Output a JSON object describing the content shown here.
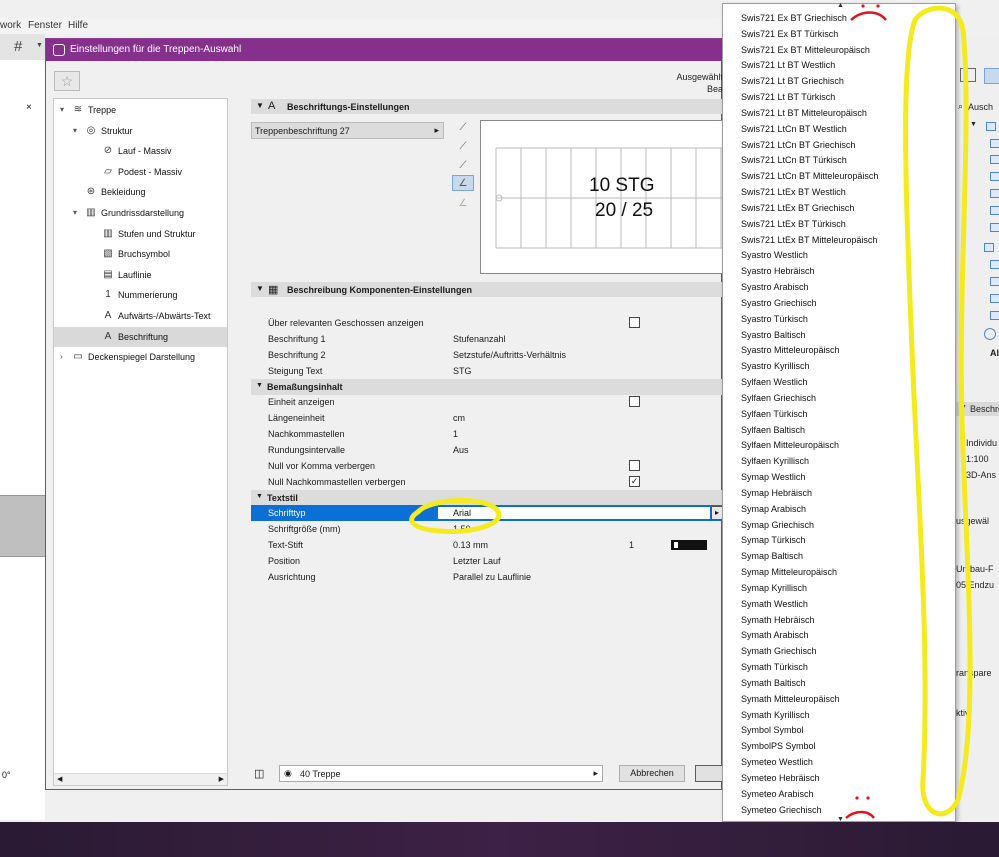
{
  "menubar": {
    "items": [
      "work",
      "Fenster",
      "Hilfe"
    ]
  },
  "right_panel": {
    "search_text": "Ausch",
    "all_label": "Al",
    "beschr_label": "Beschre",
    "individ_label": "Individu",
    "scale_label": "1:100",
    "sd_label": "3D-Ans",
    "ausgew_label": "usgewäl",
    "umbau_label": "Umbau-F",
    "endz_label": "05 Endzu",
    "transp_label": "ranspare",
    "aktiv_label": "ktiv:"
  },
  "left_panel": {
    "angle": "0°"
  },
  "dialog": {
    "title": "Einstellungen für die Treppen-Auswahl",
    "selection_info": [
      "Ausgewählt",
      "Bea"
    ],
    "tree": [
      {
        "label": "Treppe",
        "level": 0,
        "expanded": true,
        "icon": "stair-icon"
      },
      {
        "label": "Struktur",
        "level": 1,
        "expanded": true,
        "icon": "structure-icon"
      },
      {
        "label": "Lauf - Massiv",
        "level": 2,
        "icon": "flight-icon"
      },
      {
        "label": "Podest - Massiv",
        "level": 2,
        "icon": "landing-icon"
      },
      {
        "label": "Bekleidung",
        "level": 1,
        "icon": "cladding-icon"
      },
      {
        "label": "Grundrissdarstellung",
        "level": 1,
        "expanded": true,
        "icon": "floorplan-icon"
      },
      {
        "label": "Stufen und Struktur",
        "level": 2,
        "icon": "treads-icon"
      },
      {
        "label": "Bruchsymbol",
        "level": 2,
        "icon": "break-mark-icon"
      },
      {
        "label": "Lauflinie",
        "level": 2,
        "icon": "walkline-icon"
      },
      {
        "label": "Nummerierung",
        "level": 2,
        "icon": "numbering-icon"
      },
      {
        "label": "Aufwärts-/Abwärts-Text",
        "level": 2,
        "icon": "up-down-text-icon"
      },
      {
        "label": "Beschriftung",
        "level": 2,
        "icon": "label-icon",
        "selected": true
      },
      {
        "label": "Deckenspiegel Darstellung",
        "level": 0,
        "expanded": false,
        "icon": "ceiling-icon"
      }
    ],
    "label_section": {
      "header": "Beschriftungs-Einstellungen",
      "dropdown_value": "Treppenbeschriftung 27",
      "preview_line1": "10 STG",
      "preview_line2": "20 / 25"
    },
    "components_section": {
      "header": "Beschreibung Komponenten-Einstellungen",
      "rows": [
        {
          "type": "row",
          "key": "Über relevanten Geschossen anzeigen",
          "checkbox": false
        },
        {
          "type": "row",
          "key": "Beschriftung 1",
          "value": "Stufenanzahl"
        },
        {
          "type": "row",
          "key": "Beschriftung 2",
          "value": "Setzstufe/Auftritts-Verhältnis"
        },
        {
          "type": "row",
          "key": "Steigung Text",
          "value": "STG"
        },
        {
          "type": "group",
          "key": "Bemaßungsinhalt"
        },
        {
          "type": "row",
          "key": "Einheit anzeigen",
          "checkbox": false
        },
        {
          "type": "row",
          "key": "Längeneinheit",
          "value": "cm"
        },
        {
          "type": "row",
          "key": "Nachkommastellen",
          "value": "1"
        },
        {
          "type": "row",
          "key": "Rundungsintervalle",
          "value": "Aus"
        },
        {
          "type": "row",
          "key": "Null vor Komma verbergen",
          "checkbox": false
        },
        {
          "type": "row",
          "key": "Null Nachkommastellen verbergen",
          "checkbox": true
        },
        {
          "type": "group",
          "key": "Textstil"
        },
        {
          "type": "font",
          "key": "Schrifttyp",
          "value": "Arial"
        },
        {
          "type": "row",
          "key": "Schriftgröße (mm)",
          "value": "1.50"
        },
        {
          "type": "pen",
          "key": "Text-Stift",
          "value": "0.13 mm",
          "pen_number": "1"
        },
        {
          "type": "row",
          "key": "Position",
          "value": "Letzter Lauf"
        },
        {
          "type": "row",
          "key": "Ausrichtung",
          "value": "Parallel zu Lauflinie"
        }
      ]
    },
    "footer": {
      "layer": "40 Treppe",
      "cancel_label": "Abbrechen"
    }
  },
  "font_list": [
    "Swis721 Ex BT Griechisch",
    "Swis721 Ex BT Türkisch",
    "Swis721 Ex BT Mitteleuropäisch",
    "Swis721 Lt BT Westlich",
    "Swis721 Lt BT Griechisch",
    "Swis721 Lt BT Türkisch",
    "Swis721 Lt BT Mitteleuropäisch",
    "Swis721 LtCn BT Westlich",
    "Swis721 LtCn BT Griechisch",
    "Swis721 LtCn BT Türkisch",
    "Swis721 LtCn BT Mitteleuropäisch",
    "Swis721 LtEx BT Westlich",
    "Swis721 LtEx BT Griechisch",
    "Swis721 LtEx BT Türkisch",
    "Swis721 LtEx BT Mitteleuropäisch",
    "Syastro Westlich",
    "Syastro Hebräisch",
    "Syastro Arabisch",
    "Syastro Griechisch",
    "Syastro Türkisch",
    "Syastro Baltisch",
    "Syastro Mitteleuropäisch",
    "Syastro Kyrillisch",
    "Sylfaen Westlich",
    "Sylfaen Griechisch",
    "Sylfaen Türkisch",
    "Sylfaen Baltisch",
    "Sylfaen Mitteleuropäisch",
    "Sylfaen Kyrillisch",
    "Symap Westlich",
    "Symap Hebräisch",
    "Symap Arabisch",
    "Symap Griechisch",
    "Symap Türkisch",
    "Symap Baltisch",
    "Symap Mitteleuropäisch",
    "Symap Kyrillisch",
    "Symath Westlich",
    "Symath Hebräisch",
    "Symath Arabisch",
    "Symath Griechisch",
    "Symath Türkisch",
    "Symath Baltisch",
    "Symath Mitteleuropäisch",
    "Symath Kyrillisch",
    "Symbol Symbol",
    "SymbolPS Symbol",
    "Symeteo Westlich",
    "Symeteo Hebräisch",
    "Symeteo Arabisch",
    "Symeteo Griechisch"
  ],
  "colors": {
    "title_bar": "#86308e",
    "selection": "#0b6fd6",
    "annotation_yellow": "#f3ea1f",
    "annotation_red": "#e0141e"
  }
}
